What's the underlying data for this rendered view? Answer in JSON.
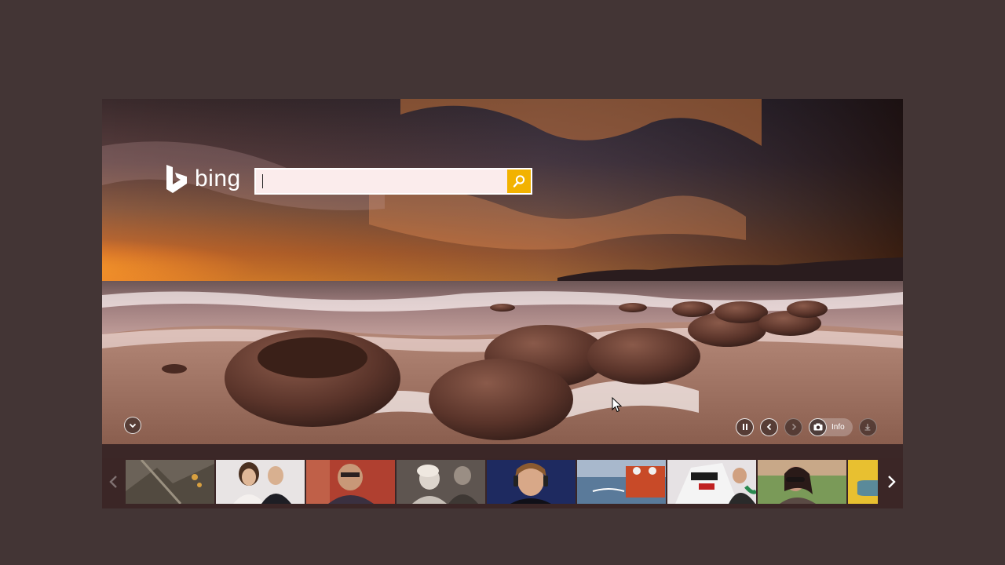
{
  "brand": {
    "name": "bing"
  },
  "search": {
    "value": "",
    "placeholder": ""
  },
  "icons": {
    "logo": "bing-logo-icon",
    "search": "search-icon",
    "scroll_down": "chevron-down-icon",
    "pause": "pause-icon",
    "previous": "chevron-left-icon",
    "next": "chevron-right-icon",
    "camera": "camera-icon",
    "download": "download-icon",
    "strip_prev": "chevron-left-icon",
    "strip_next": "chevron-right-icon"
  },
  "controls": {
    "info_label": "Info"
  },
  "colors": {
    "page_bg": "#433535",
    "search_button": "#f2b200",
    "search_field": "#fbecec"
  },
  "news_strip": {
    "thumbnails": [
      {
        "name": "thumb-1"
      },
      {
        "name": "thumb-2"
      },
      {
        "name": "thumb-3"
      },
      {
        "name": "thumb-4"
      },
      {
        "name": "thumb-5"
      },
      {
        "name": "thumb-6"
      },
      {
        "name": "thumb-7"
      },
      {
        "name": "thumb-8"
      },
      {
        "name": "thumb-9"
      }
    ]
  }
}
